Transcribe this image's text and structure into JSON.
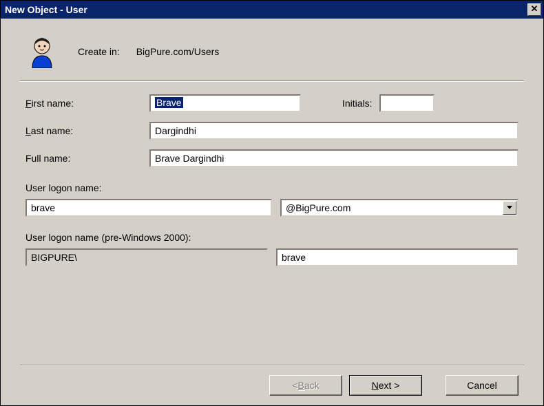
{
  "window": {
    "title": "New Object - User"
  },
  "header": {
    "create_in_label": "Create in:",
    "create_in_path": "BigPure.com/Users",
    "icon_name": "user-wizard-icon"
  },
  "form": {
    "first_name_label": "First name:",
    "first_name_value": "Brave",
    "initials_label": "Initials:",
    "initials_value": "",
    "last_name_label": "Last name:",
    "last_name_value": "Dargindhi",
    "full_name_label": "Full name:",
    "full_name_value": "Brave Dargindhi",
    "logon_name_label": "User logon name:",
    "logon_name_value": "brave",
    "domain_selected": "@BigPure.com",
    "prewin_label": "User logon name (pre-Windows 2000):",
    "prewin_domain": "BIGPURE\\",
    "prewin_user": "brave"
  },
  "buttons": {
    "back": "< Back",
    "next": "Next >",
    "cancel": "Cancel"
  }
}
